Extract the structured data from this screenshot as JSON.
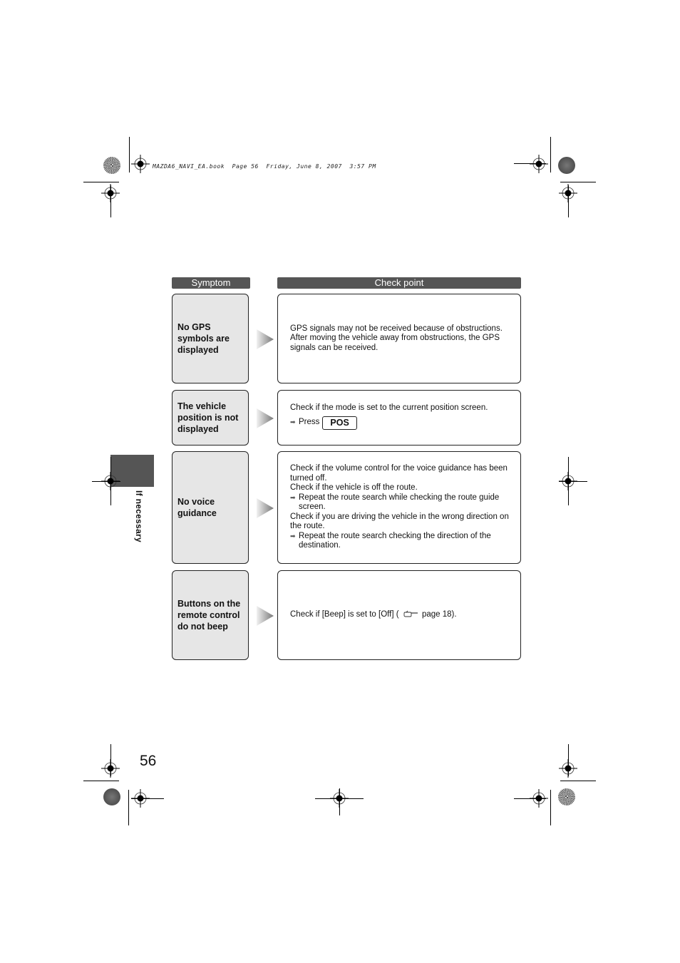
{
  "print_header": "MAZDA6_NAVI_EA.book  Page 56  Friday, June 8, 2007  3:57 PM",
  "columns": {
    "symptom": "Symptom",
    "check_point": "Check point"
  },
  "rows": [
    {
      "symptom": "No GPS symbols are displayed",
      "check": [
        {
          "type": "text",
          "text": "GPS signals may not be received because of obstructions. After moving the vehicle away from obstructions, the GPS signals can be received."
        }
      ]
    },
    {
      "symptom": "The vehicle position is not displayed",
      "check": [
        {
          "type": "text",
          "text": "Check if the mode is set to the current position screen."
        },
        {
          "type": "press",
          "text": "Press",
          "button": "POS"
        }
      ]
    },
    {
      "symptom": "No voice guidance",
      "check": [
        {
          "type": "text",
          "text": "Check if the volume control for the voice guidance has been turned off."
        },
        {
          "type": "text",
          "text": "Check if the vehicle is off the route."
        },
        {
          "type": "bullet",
          "text": "Repeat the route search while checking the route guide screen."
        },
        {
          "type": "text",
          "text": "Check if you are driving the vehicle in the wrong direction on the route."
        },
        {
          "type": "bullet",
          "text": "Repeat the route search checking the direction of the destination."
        }
      ]
    },
    {
      "symptom": "Buttons on the remote control do not beep",
      "check": [
        {
          "type": "ref",
          "before": "Check if [Beep] is set to [Off] (",
          "icon": "pointing-hand-icon",
          "after": " page 18)."
        }
      ]
    }
  ],
  "icons": {
    "arrow_bullet": "➡",
    "row_arrow": "gradient-triangle-right"
  },
  "side_tab_label": "If necessary",
  "page_number": "56"
}
